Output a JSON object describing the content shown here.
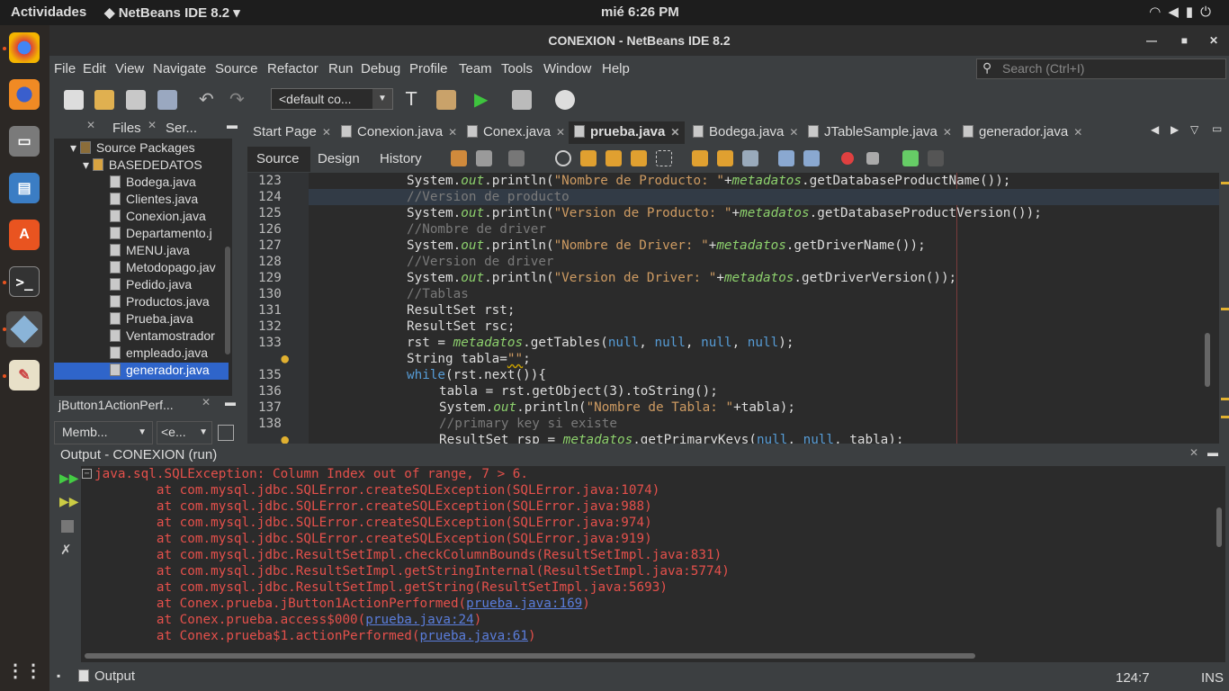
{
  "system": {
    "activities": "Actividades",
    "app_name": "NetBeans IDE 8.2",
    "clock": "mié   6:26 PM"
  },
  "window": {
    "title": "CONEXION - NetBeans IDE 8.2"
  },
  "menu": [
    "File",
    "Edit",
    "View",
    "Navigate",
    "Source",
    "Refactor",
    "Run",
    "Debug",
    "Profile",
    "Team",
    "Tools",
    "Window",
    "Help"
  ],
  "search": {
    "placeholder": "Search (Ctrl+I)"
  },
  "toolbar": {
    "config": "<default co..."
  },
  "project_tabs": {
    "files": "Files",
    "services": "Ser..."
  },
  "tree": {
    "source_packages": "Source Packages",
    "package": "BASEDEDATOS",
    "files": [
      "Bodega.java",
      "Clientes.java",
      "Conexion.java",
      "Departamento.j",
      "MENU.java",
      "Metodopago.jav",
      "Pedido.java",
      "Productos.java",
      "Prueba.java",
      "Ventamostrador",
      "empleado.java",
      "generador.java"
    ]
  },
  "navigator": {
    "title": "jButton1ActionPerf...",
    "members": "Memb...",
    "filter": "<e..."
  },
  "editor_tabs": [
    "Start Page",
    "Conexion.java",
    "Conex.java",
    "prueba.java",
    "Bodega.java",
    "JTableSample.java",
    "generador.java"
  ],
  "editor_subtabs": [
    "Source",
    "Design",
    "History"
  ],
  "line_numbers": [
    "123",
    "124",
    "125",
    "126",
    "127",
    "128",
    "129",
    "130",
    "131",
    "132",
    "133",
    "",
    "135",
    "136",
    "137",
    "138",
    ""
  ],
  "output": {
    "title": "Output - CONEXION (run)",
    "lines": [
      "java.sql.SQLException: Column Index out of range, 7 > 6.",
      "        at com.mysql.jdbc.SQLError.createSQLException(SQLError.java:1074)",
      "        at com.mysql.jdbc.SQLError.createSQLException(SQLError.java:988)",
      "        at com.mysql.jdbc.SQLError.createSQLException(SQLError.java:974)",
      "        at com.mysql.jdbc.SQLError.createSQLException(SQLError.java:919)",
      "        at com.mysql.jdbc.ResultSetImpl.checkColumnBounds(ResultSetImpl.java:831)",
      "        at com.mysql.jdbc.ResultSetImpl.getStringInternal(ResultSetImpl.java:5774)",
      "        at com.mysql.jdbc.ResultSetImpl.getString(ResultSetImpl.java:5693)"
    ],
    "linked": [
      {
        "prefix": "        at Conex.prueba.jButton1ActionPerformed(",
        "link": "prueba.java:169",
        "suffix": ")"
      },
      {
        "prefix": "        at Conex.prueba.access$000(",
        "link": "prueba.java:24",
        "suffix": ")"
      },
      {
        "prefix": "        at Conex.prueba$1.actionPerformed(",
        "link": "prueba.java:61",
        "suffix": ")"
      }
    ]
  },
  "statusbar": {
    "output_tab": "Output",
    "position": "124:7",
    "mode": "INS"
  }
}
